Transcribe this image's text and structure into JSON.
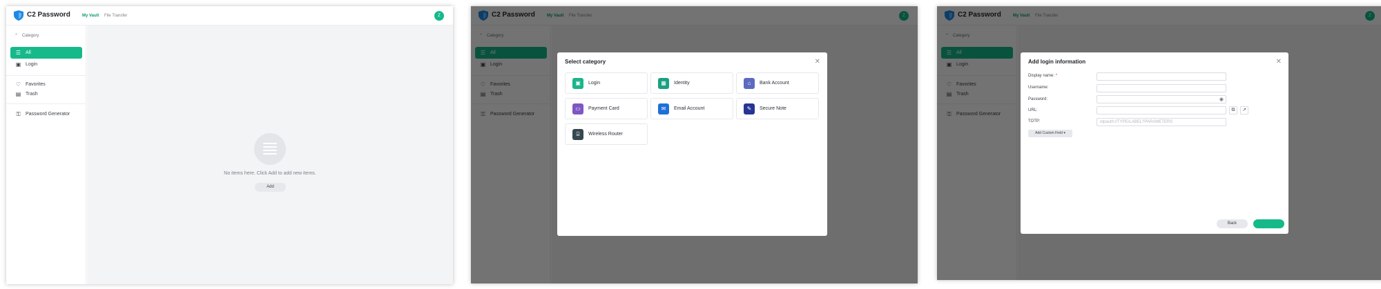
{
  "app": {
    "title": "C2 Password",
    "nav": [
      "My Vault",
      "File Transfer"
    ],
    "avatar_initial": "Z"
  },
  "sidebar": {
    "category_label": "Category",
    "items": [
      {
        "label": "All",
        "icon": "list-icon"
      },
      {
        "label": "Login",
        "icon": "login-icon"
      },
      {
        "label": "Favorites",
        "icon": "heart-icon"
      },
      {
        "label": "Trash",
        "icon": "trash-icon"
      },
      {
        "label": "Password Generator",
        "icon": "key-icon"
      }
    ]
  },
  "empty_state": {
    "message": "No items here. Click Add to add new items.",
    "add_label": "Add"
  },
  "select_category_modal": {
    "title": "Select category",
    "categories": [
      {
        "label": "Login",
        "color": "#1bb58a"
      },
      {
        "label": "Identity",
        "color": "#1aa082"
      },
      {
        "label": "Bank Account",
        "color": "#5c6bc0"
      },
      {
        "label": "Payment Card",
        "color": "#7e57c2"
      },
      {
        "label": "Email Account",
        "color": "#1e6fd9"
      },
      {
        "label": "Secure Note",
        "color": "#283593"
      },
      {
        "label": "Wireless Router",
        "color": "#37474f"
      }
    ]
  },
  "login_modal": {
    "title": "Add login information",
    "fields": [
      {
        "label": "Display name:",
        "required": true,
        "value": ""
      },
      {
        "label": "Username:",
        "required": false,
        "value": ""
      },
      {
        "label": "Password:",
        "required": false,
        "value": ""
      },
      {
        "label": "URL:",
        "required": false,
        "value": ""
      },
      {
        "label": "TOTP:",
        "required": false,
        "placeholder": "otpauth://TYPE/LABEL?PARAMETERS"
      }
    ],
    "required_mark": "*",
    "add_custom_field_label": "Add Custom Field",
    "back_label": "Back",
    "next_label": ""
  },
  "colors": {
    "accent": "#16b98a",
    "overlay": "rgba(0,0,0,0.55)"
  }
}
